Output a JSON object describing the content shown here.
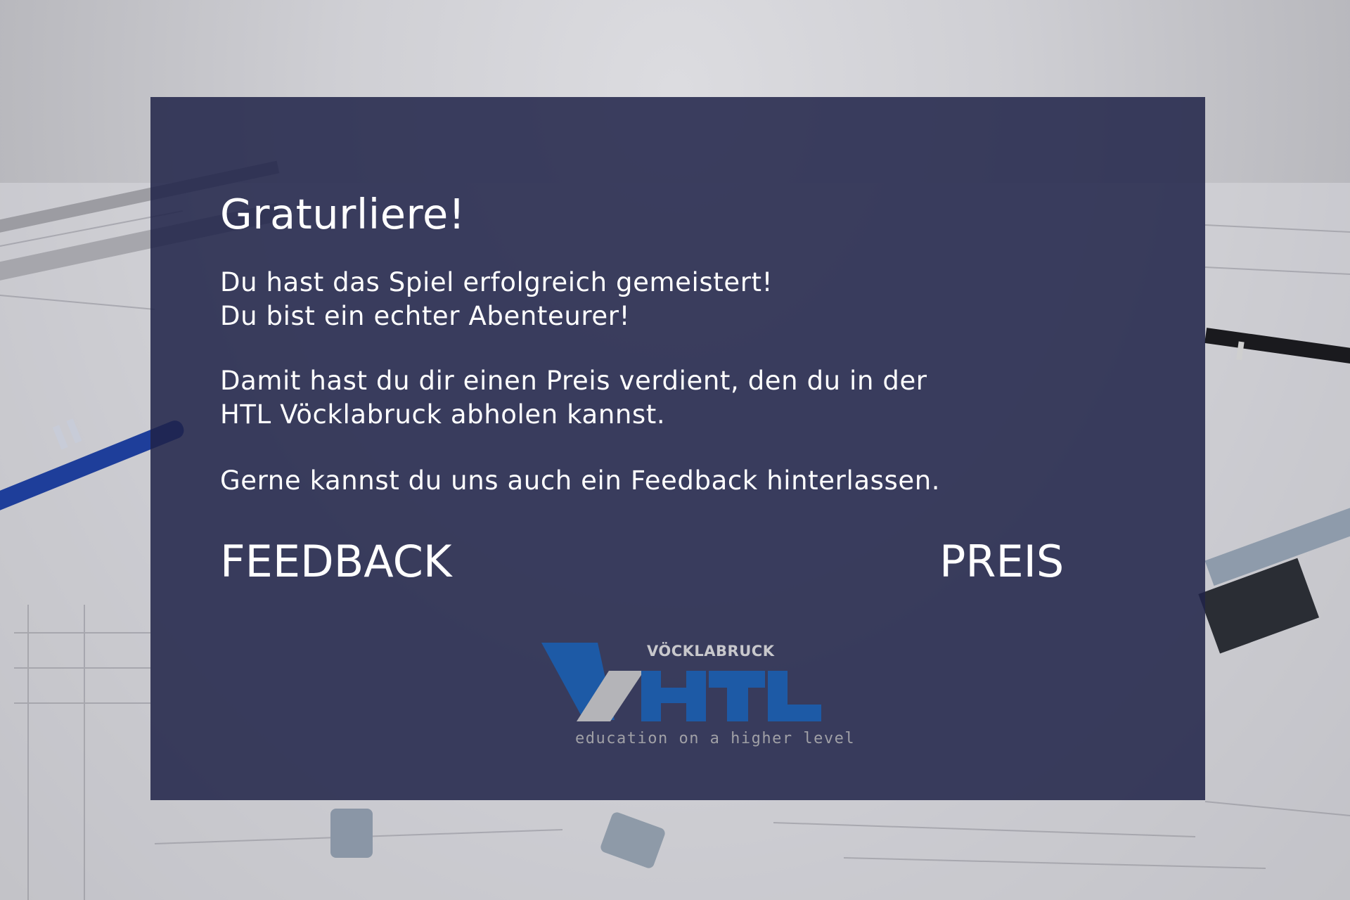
{
  "dialog": {
    "title": "Graturliere!",
    "lines": [
      "Du hast das Spiel erfolgreich gemeistert!",
      "Du bist ein echter Abenteurer!",
      "Damit hast du dir einen Preis verdient, den du in der",
      "HTL Vöcklabruck abholen kannst.",
      "Gerne kannst du uns auch ein Feedback hinterlassen."
    ],
    "feedback_button": "FEEDBACK",
    "prize_button": "PREIS"
  },
  "logo": {
    "town": "VÖCKLABRUCK",
    "tagline": "education on a higher level",
    "colors": {
      "blue": "#1d5aa6",
      "gray": "#b4b4b8"
    }
  },
  "colors": {
    "panel": "#1f2348",
    "text": "#ffffff"
  }
}
